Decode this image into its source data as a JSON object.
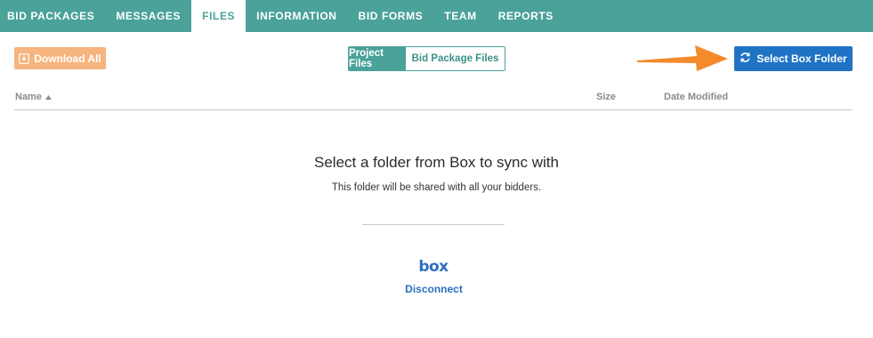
{
  "nav": {
    "tabs": [
      {
        "label": "BID PACKAGES"
      },
      {
        "label": "MESSAGES"
      },
      {
        "label": "FILES",
        "active": true
      },
      {
        "label": "INFORMATION"
      },
      {
        "label": "BID FORMS"
      },
      {
        "label": "TEAM"
      },
      {
        "label": "REPORTS"
      }
    ]
  },
  "toolbar": {
    "download_all_label": "Download All",
    "segment": {
      "project_files": "Project Files",
      "bid_package_files": "Bid Package Files",
      "selected": "Project Files"
    },
    "select_box_folder_label": "Select Box Folder"
  },
  "table": {
    "columns": {
      "name": "Name",
      "size": "Size",
      "date_modified": "Date Modified"
    },
    "sort": {
      "column": "Name",
      "direction": "ascending"
    }
  },
  "empty_state": {
    "title": "Select a folder from Box to sync with",
    "subtitle": "This folder will be shared with all your bidders.",
    "logo_text": "box",
    "disconnect_label": "Disconnect"
  },
  "colors": {
    "nav_bg": "#4aa29a",
    "download_button": "#f6b47e",
    "box_button": "#1f73c4",
    "arrow": "#f38a2c",
    "box_brand": "#2c6fc0"
  },
  "icons": {
    "download": "download-icon",
    "refresh": "refresh-icon",
    "sort": "sort-up-icon",
    "annotation": "arrow-annotation-icon"
  }
}
